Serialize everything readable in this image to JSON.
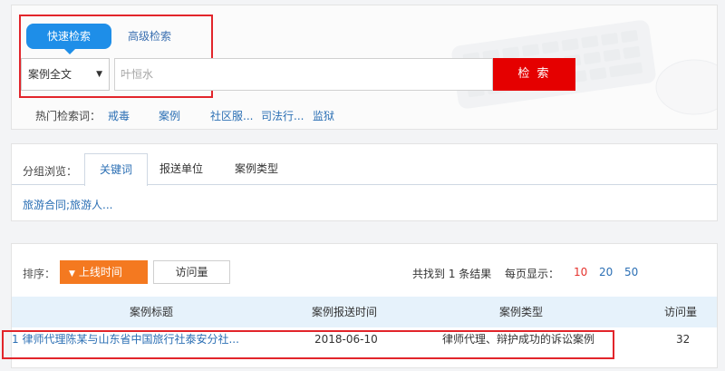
{
  "search": {
    "tab_quick": "快速检索",
    "tab_advanced": "高级检索",
    "scope_selected": "案例全文",
    "input_placeholder": "叶恒水",
    "button": "检 索",
    "hot_label": "热门检索词：",
    "hot_terms": [
      "戒毒",
      "案例",
      "社区服...",
      "司法行...",
      "监狱"
    ]
  },
  "browse": {
    "label": "分组浏览：",
    "tabs": [
      "关键词",
      "报送单位",
      "案例类型"
    ],
    "content": "旅游合同;旅游人..."
  },
  "results": {
    "sort_label": "排序：",
    "sort_online": "上线时间",
    "sort_visits": "访问量",
    "found_text": "共找到 1 条结果",
    "per_page_label": "每页显示：",
    "per_page_options": [
      "10",
      "20",
      "50"
    ],
    "columns": [
      "案例标题",
      "案例报送时间",
      "案例类型",
      "访问量"
    ],
    "rows": [
      {
        "title": "1 律师代理陈某与山东省中国旅行社泰安分社...",
        "date": "2018-06-10",
        "type": "律师代理、辩护成功的诉讼案例",
        "visits": "32"
      }
    ]
  },
  "colors": {
    "accent_blue": "#1e8ee8",
    "search_red": "#e50000",
    "sort_orange": "#f47920",
    "highlight_red": "#e2252b"
  }
}
